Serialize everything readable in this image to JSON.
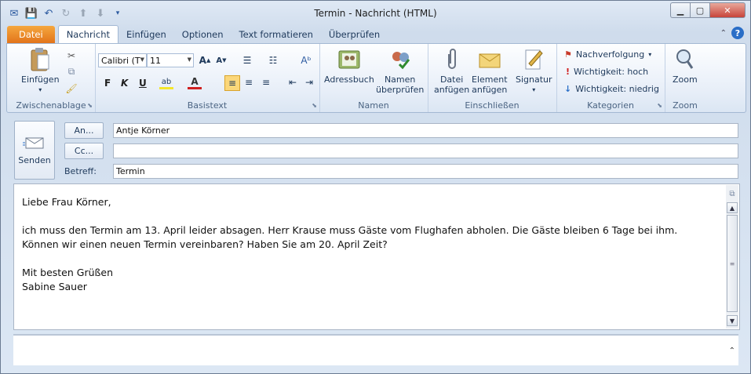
{
  "window": {
    "title": "Termin - Nachricht (HTML)"
  },
  "qat": {
    "icons": [
      "outlook-icon",
      "save-icon",
      "undo-icon",
      "redo-icon",
      "up-arrow-icon",
      "down-arrow-icon",
      "customize-icon"
    ]
  },
  "tabs": [
    {
      "label": "Datei"
    },
    {
      "label": "Nachricht"
    },
    {
      "label": "Einfügen"
    },
    {
      "label": "Optionen"
    },
    {
      "label": "Text formatieren"
    },
    {
      "label": "Überprüfen"
    }
  ],
  "ribbon": {
    "clipboard": {
      "label": "Zwischenablage",
      "paste": "Einfügen"
    },
    "basictext": {
      "label": "Basistext",
      "font": "Calibri (T",
      "size": "11",
      "bold": "F",
      "italic": "K",
      "underline": "U"
    },
    "names": {
      "label": "Namen",
      "addressbook": "Adressbuch",
      "checknames_1": "Namen",
      "checknames_2": "überprüfen"
    },
    "include": {
      "label": "Einschließen",
      "attachfile_1": "Datei",
      "attachfile_2": "anfügen",
      "attachitem_1": "Element",
      "attachitem_2": "anfügen",
      "signature": "Signatur"
    },
    "tags": {
      "label": "Kategorien",
      "followup": "Nachverfolgung",
      "high": "Wichtigkeit: hoch",
      "low": "Wichtigkeit: niedrig"
    },
    "zoom": {
      "label": "Zoom",
      "button": "Zoom"
    }
  },
  "compose": {
    "send": "Senden",
    "to_button": "An...",
    "cc_button": "Cc...",
    "subject_label": "Betreff:",
    "to": "Antje Körner",
    "cc": "",
    "subject": "Termin"
  },
  "body": {
    "greeting": "Liebe Frau Körner,",
    "paragraph": "ich muss den Termin am 13. April leider absagen. Herr Krause muss Gäste vom Flughafen abholen. Die Gäste bleiben 6 Tage bei ihm. Können wir einen neuen Termin vereinbaren? Haben Sie am 20. April Zeit?",
    "closing": "Mit besten Grüßen",
    "signature": "Sabine Sauer"
  },
  "colors": {
    "file_tab": "#e2741b",
    "accent": "#2a6ec7",
    "close": "#c7443a"
  }
}
